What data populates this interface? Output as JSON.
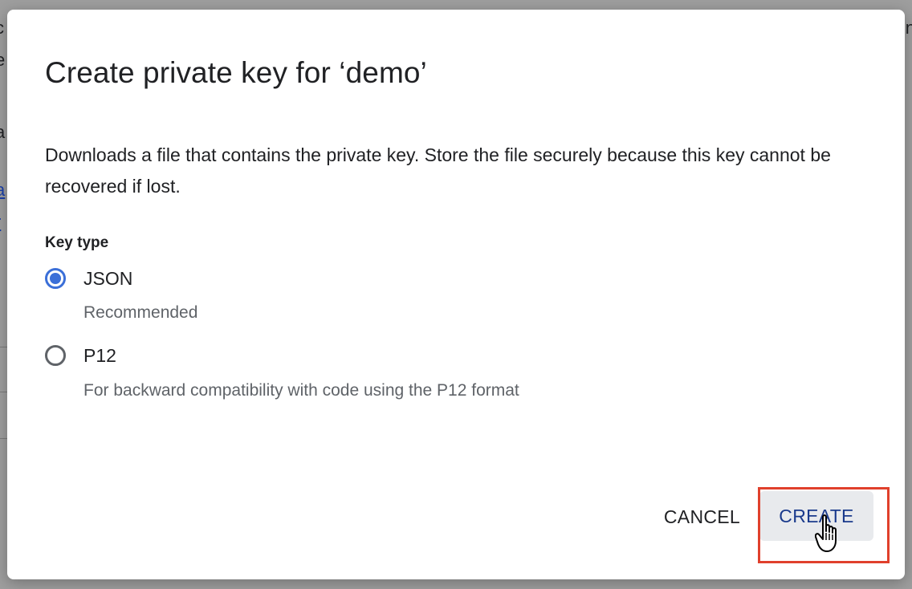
{
  "dialog": {
    "title": "Create private key for ‘demo’",
    "description": "Downloads a file that contains the private key. Store the file securely because this key cannot be recovered if lost.",
    "key_type_label": "Key type",
    "options": [
      {
        "label": "JSON",
        "helper": "Recommended",
        "selected": true
      },
      {
        "label": "P12",
        "helper": "For backward compatibility with code using the P12 format",
        "selected": false
      }
    ],
    "cancel_label": "CANCEL",
    "create_label": "CREATE"
  },
  "colors": {
    "radio_accent": "#3b6fd8",
    "create_text": "#1a3a8c",
    "highlight": "#e0402c"
  },
  "icons": {
    "cursor": "hand-pointer-icon"
  }
}
